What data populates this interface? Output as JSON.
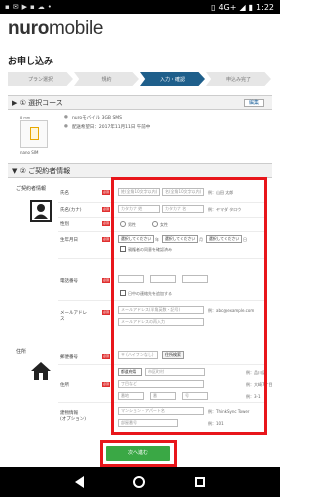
{
  "status_bar": {
    "left_icons": [
      "notification-icon",
      "mail-icon",
      "play-icon",
      "store-icon",
      "cloud-icon",
      "more-icon"
    ],
    "network": "4G+",
    "time": "1:22"
  },
  "header": {
    "logo_bold": "nuro",
    "logo_light": "mobile"
  },
  "page": {
    "title": "お申し込み"
  },
  "steps": [
    {
      "label": "プラン選択",
      "active": false
    },
    {
      "label": "規約",
      "active": false
    },
    {
      "label": "入力・確認",
      "active": true
    },
    {
      "label": "申込み完了",
      "active": false
    }
  ],
  "section1": {
    "title": "▶ ① 選択コース",
    "edit_label": "編集",
    "sim_caption": "nano SIM",
    "sim_size_label": "8 mm",
    "plan_items": [
      {
        "bullet": "●",
        "text": "nuroモバイル 3GB SMS"
      },
      {
        "bullet": "●",
        "text": "配送希望日：2017年11月11日 午前中"
      }
    ]
  },
  "section2": {
    "title": "▼ ② ご契約者情報",
    "contractor_group": "ご契約者情報",
    "address_group": "住所",
    "rows": {
      "name_label": "氏名",
      "kana_label": "氏名(カナ)",
      "gender_label": "性別",
      "birthday_label": "生年月日",
      "phone_label": "電話番号",
      "email_label": "メールアドレス",
      "postal_label": "郵便番号",
      "address_label": "住所",
      "building_label": "建物情報\n(オプション)"
    },
    "required_badge": "必須",
    "fields": {
      "last_name_placeholder": "姓(全角10文字以内)",
      "first_name_placeholder": "名(全角10文字以内)",
      "name_example": "例：山田 太郎",
      "last_kana_placeholder": "カタカナ 姓",
      "first_kana_placeholder": "カタカナ 名",
      "kana_example": "例：ヤマダ タロウ",
      "gender_male": "男性",
      "gender_female": "女性",
      "year_select": "選択してください",
      "month_select": "選択してください",
      "day_select": "選択してください",
      "year_suffix": "年",
      "month_suffix": "月",
      "day_suffix": "日",
      "age_check_label": "親権者の同意を確認済み",
      "phone_alt_label": "日中の連絡先を追加する",
      "email_placeholder": "メールアドレス(半角英数・記号)",
      "email_example": "例：abc@example.com",
      "email_confirm_placeholder": "メールアドレスの再入力",
      "postal_placeholder": "〒 (ハイフンなし)",
      "postal_button": "住所検索",
      "pref_select": "都道府県",
      "city_placeholder": "市区町村",
      "city_example": "例：品川区",
      "town_placeholder": "丁目など",
      "town_example": "例：大崎7丁目",
      "block_placeholder": "番",
      "go_placeholder": "号",
      "addr_num_placeholder": "番地",
      "addr_example": "例：3-1",
      "building_placeholder": "マンション・アパート名",
      "building_example": "例：ThinkSync Tower",
      "room_placeholder": "部屋番号",
      "room_example": "例：101"
    }
  },
  "submit_label": "次へ進む",
  "highlight_color": "#e8161b",
  "accent_color": "#1f5f8b",
  "submit_color": "#3aa845"
}
